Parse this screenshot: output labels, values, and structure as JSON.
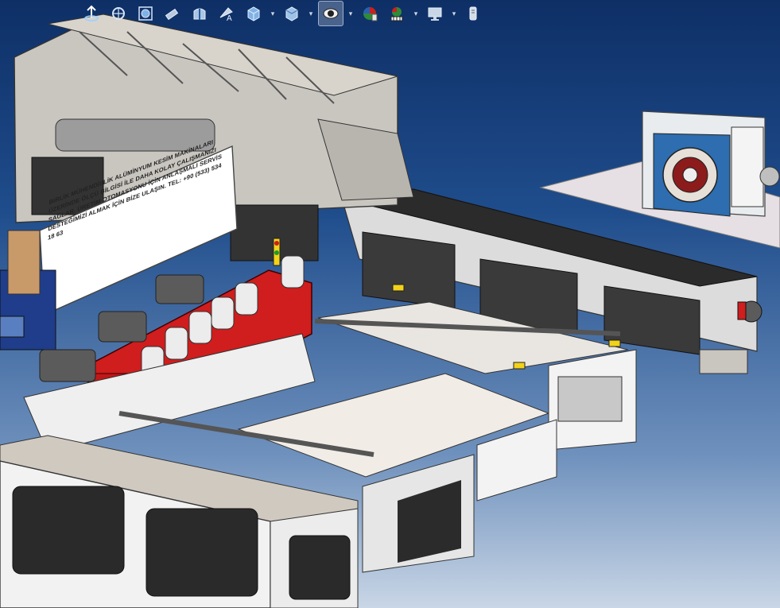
{
  "toolbar": {
    "buttons": [
      {
        "name": "view-orientation-icon",
        "active": false
      },
      {
        "name": "zoom-to-fit-icon",
        "active": false
      },
      {
        "name": "zoom-to-area-icon",
        "active": false
      },
      {
        "name": "previous-view-icon",
        "active": false
      },
      {
        "name": "section-view-icon",
        "active": false
      },
      {
        "name": "dynamic-annotation-views-icon",
        "active": false
      },
      {
        "name": "view-orientation-cube-icon",
        "active": false,
        "dropdown": true
      },
      {
        "name": "display-style-icon",
        "active": false,
        "dropdown": true
      },
      {
        "name": "hide-show-items-icon",
        "active": true,
        "dropdown": true
      },
      {
        "name": "edit-appearance-icon",
        "active": false
      },
      {
        "name": "apply-scene-icon",
        "active": false,
        "dropdown": true
      },
      {
        "name": "view-settings-icon",
        "active": false,
        "dropdown": true
      },
      {
        "name": "display-pane-icon",
        "active": false
      }
    ]
  },
  "notice_sign": {
    "text": "BIRLİK MÜHENDİSLİK ALÜMİNYUM KESİM MAKİNALARI ÜZERİNDE ÖLÇÜ BİLGİSİ İLE DAHA KOLAY ÇALIŞMANIZI SAĞLAR. ÜRETİM OTOMASYONU İÇİN ANLAŞMALI SERVİS DESTEĞİMİZİ ALMAK İÇİN BİZE ULAŞIN. TEL: +90 (533) 534 18 63"
  },
  "colors": {
    "background_top": "#0e2f66",
    "background_bottom": "#c9d6e6",
    "frame_grey": "#c9c6c0",
    "machine_red": "#d01d1d",
    "motor_blue": "#1f3d8a",
    "accent_yellow": "#f2d21a"
  }
}
